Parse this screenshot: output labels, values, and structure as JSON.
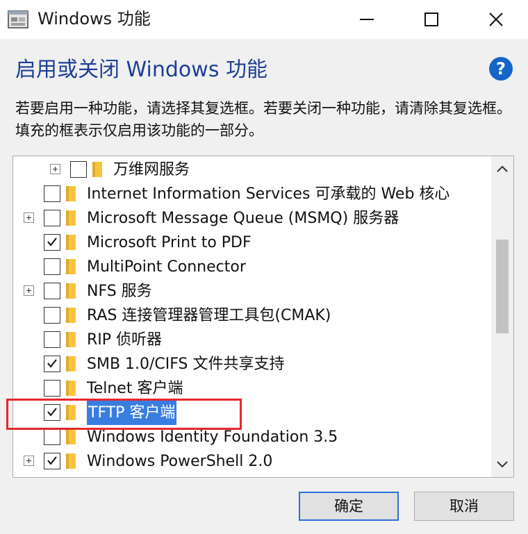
{
  "window": {
    "title": "Windows 功能",
    "heading": "启用或关闭 Windows 功能",
    "description": "若要启用一种功能，请选择其复选框。若要关闭一种功能，请清除其复选框。填充的框表示仅启用该功能的一部分。",
    "help_label": "?"
  },
  "features": [
    {
      "label": "万维网服务",
      "checked": false,
      "expandable": true,
      "indent": 1,
      "selected": false
    },
    {
      "label": "Internet Information Services 可承载的 Web 核心",
      "checked": false,
      "expandable": false,
      "indent": 0,
      "selected": false
    },
    {
      "label": "Microsoft Message Queue (MSMQ) 服务器",
      "checked": false,
      "expandable": true,
      "indent": 0,
      "selected": false
    },
    {
      "label": "Microsoft Print to PDF",
      "checked": true,
      "expandable": false,
      "indent": 0,
      "selected": false
    },
    {
      "label": "MultiPoint Connector",
      "checked": false,
      "expandable": false,
      "indent": 0,
      "selected": false
    },
    {
      "label": "NFS 服务",
      "checked": false,
      "expandable": true,
      "indent": 0,
      "selected": false
    },
    {
      "label": "RAS 连接管理器管理工具包(CMAK)",
      "checked": false,
      "expandable": false,
      "indent": 0,
      "selected": false
    },
    {
      "label": "RIP 侦听器",
      "checked": false,
      "expandable": false,
      "indent": 0,
      "selected": false
    },
    {
      "label": "SMB 1.0/CIFS 文件共享支持",
      "checked": true,
      "expandable": false,
      "indent": 0,
      "selected": false
    },
    {
      "label": "Telnet 客户端",
      "checked": false,
      "expandable": false,
      "indent": 0,
      "selected": false
    },
    {
      "label": "TFTP 客户端",
      "checked": true,
      "expandable": false,
      "indent": 0,
      "selected": true
    },
    {
      "label": "Windows Identity Foundation 3.5",
      "checked": false,
      "expandable": false,
      "indent": 0,
      "selected": false
    },
    {
      "label": "Windows PowerShell 2.0",
      "checked": true,
      "expandable": true,
      "indent": 0,
      "selected": false
    }
  ],
  "buttons": {
    "ok": "确定",
    "cancel": "取消"
  },
  "colors": {
    "heading": "#1f3f99",
    "selection": "#3a7de0",
    "highlight_box": "#e8262b",
    "folder": "#f5c542"
  }
}
